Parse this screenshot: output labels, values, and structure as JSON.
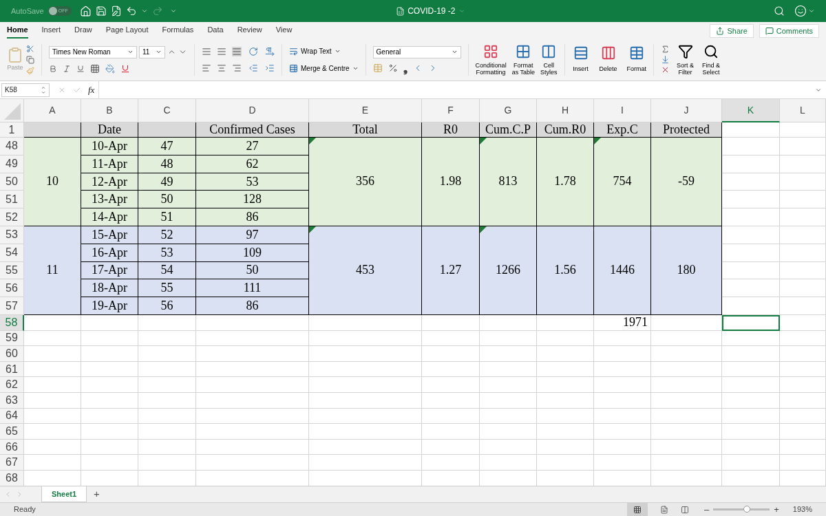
{
  "title_bar": {
    "autosave_label": "AutoSave",
    "autosave_on": false,
    "autosave_state": "OFF",
    "title": "COVID-19 -2"
  },
  "menu_tabs": [
    {
      "label": "Home",
      "selected": true
    },
    {
      "label": "Insert",
      "selected": false
    },
    {
      "label": "Draw",
      "selected": false
    },
    {
      "label": "Page Layout",
      "selected": false
    },
    {
      "label": "Formulas",
      "selected": false
    },
    {
      "label": "Data",
      "selected": false
    },
    {
      "label": "Review",
      "selected": false
    },
    {
      "label": "View",
      "selected": false
    }
  ],
  "share_button": "Share",
  "comments_button": "Comments",
  "ribbon": {
    "paste": "Paste",
    "font_name": "Times New Roman",
    "font_size": "11",
    "wrap_text": "Wrap Text",
    "merge": "Merge & Centre",
    "number_format": "General",
    "comma": "❟",
    "styles": [
      "Conditional\nFormatting",
      "Format\nas Table",
      "Cell\nStyles"
    ],
    "cells": [
      "Insert",
      "Delete",
      "Format"
    ],
    "editing": [
      "Sort &\nFilter",
      "Find &\nSelect"
    ]
  },
  "formula_bar": {
    "name_box": "K58",
    "fx": "fx"
  },
  "columns": [
    {
      "label": "A",
      "selected": false
    },
    {
      "label": "B",
      "selected": false
    },
    {
      "label": "C",
      "selected": false
    },
    {
      "label": "D",
      "selected": false
    },
    {
      "label": "E",
      "selected": false
    },
    {
      "label": "F",
      "selected": false
    },
    {
      "label": "G",
      "selected": false
    },
    {
      "label": "H",
      "selected": false
    },
    {
      "label": "I",
      "selected": false
    },
    {
      "label": "J",
      "selected": false
    },
    {
      "label": "K",
      "selected": true
    },
    {
      "label": "L",
      "selected": false
    }
  ],
  "header_row": {
    "number": "1",
    "cells": [
      "",
      "Date",
      "",
      "Confirmed Cases",
      "Total",
      "R0",
      "Cum.C.P",
      "Cum.R0",
      "Exp.C",
      "Protected"
    ]
  },
  "groups": [
    {
      "week": "10",
      "color": "#e2efda",
      "rows": [
        {
          "number": "48",
          "date": "10-Apr",
          "day": "47",
          "cases": "27"
        },
        {
          "number": "49",
          "date": "11-Apr",
          "day": "48",
          "cases": "62"
        },
        {
          "number": "50",
          "date": "12-Apr",
          "day": "49",
          "cases": "53"
        },
        {
          "number": "51",
          "date": "13-Apr",
          "day": "50",
          "cases": "128"
        },
        {
          "number": "52",
          "date": "14-Apr",
          "day": "51",
          "cases": "86"
        }
      ],
      "summary": [
        {
          "text": "356",
          "flagged": true
        },
        {
          "text": "1.98",
          "flagged": false
        },
        {
          "text": "813",
          "flagged": true
        },
        {
          "text": "1.78",
          "flagged": false
        },
        {
          "text": "754",
          "flagged": true
        },
        {
          "text": "-59",
          "flagged": false
        }
      ]
    },
    {
      "week": "11",
      "color": "#d9e1f2",
      "rows": [
        {
          "number": "53",
          "date": "15-Apr",
          "day": "52",
          "cases": "97"
        },
        {
          "number": "54",
          "date": "16-Apr",
          "day": "53",
          "cases": "109"
        },
        {
          "number": "55",
          "date": "17-Apr",
          "day": "54",
          "cases": "50"
        },
        {
          "number": "56",
          "date": "18-Apr",
          "day": "55",
          "cases": "111"
        },
        {
          "number": "57",
          "date": "19-Apr",
          "day": "56",
          "cases": "86"
        }
      ],
      "summary": [
        {
          "text": "453",
          "flagged": true
        },
        {
          "text": "1.27",
          "flagged": false
        },
        {
          "text": "1266",
          "flagged": true
        },
        {
          "text": "1.56",
          "flagged": false
        },
        {
          "text": "1446",
          "flagged": false
        },
        {
          "text": "180",
          "flagged": false
        }
      ]
    }
  ],
  "empty_rows": [
    {
      "number": "58",
      "selected": true,
      "i_value": "1971"
    },
    {
      "number": "59",
      "selected": false
    },
    {
      "number": "60",
      "selected": false
    },
    {
      "number": "61",
      "selected": false
    },
    {
      "number": "62",
      "selected": false
    },
    {
      "number": "63",
      "selected": false
    },
    {
      "number": "64",
      "selected": false
    },
    {
      "number": "65",
      "selected": false
    },
    {
      "number": "66",
      "selected": false
    },
    {
      "number": "67",
      "selected": false
    },
    {
      "number": "68",
      "selected": false
    }
  ],
  "sheet_tabs": [
    {
      "label": "Sheet1",
      "selected": true
    }
  ],
  "add_sheet": "+",
  "status_bar": {
    "status": "Ready",
    "zoom": {
      "level": 0.6
    },
    "zoom_minus": "–",
    "zoom_plus": "+",
    "zoom_text": "193%"
  }
}
